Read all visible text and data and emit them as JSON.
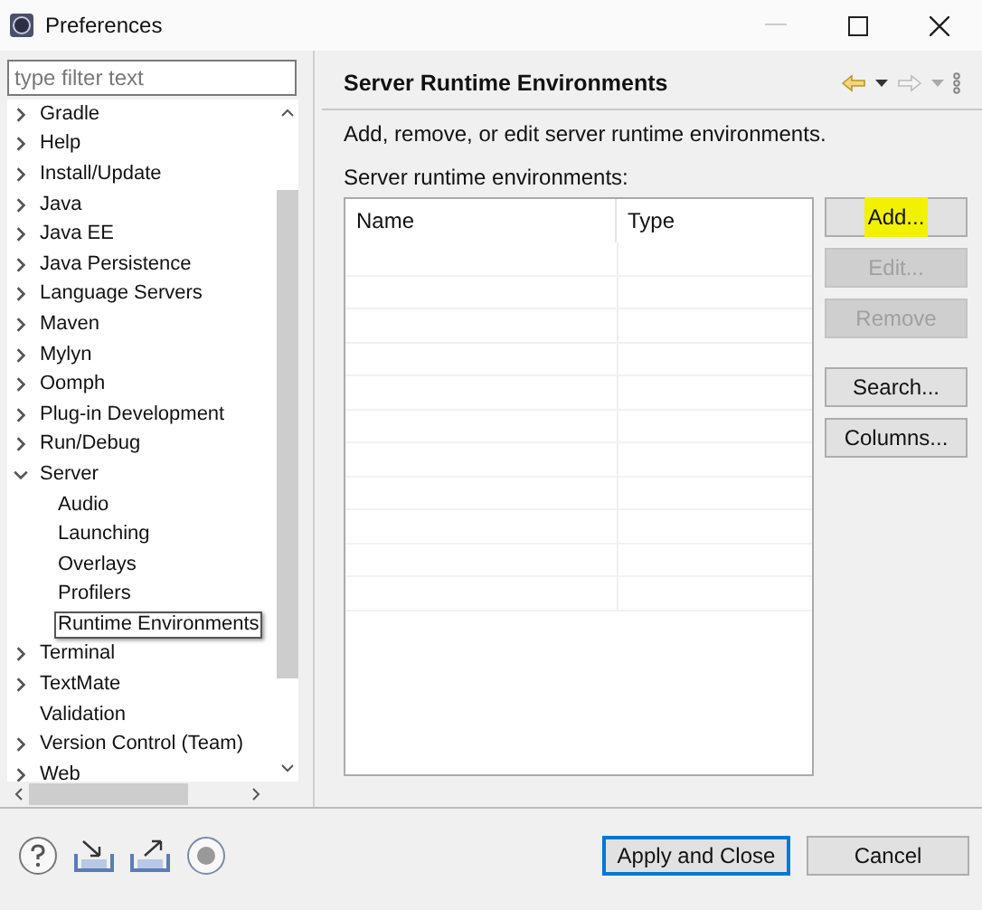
{
  "window": {
    "title": "Preferences"
  },
  "filter": {
    "placeholder": "type filter text"
  },
  "tree": [
    {
      "label": "Gradle",
      "expandable": true,
      "expanded": false,
      "selected": false
    },
    {
      "label": "Help",
      "expandable": true,
      "expanded": false,
      "selected": false
    },
    {
      "label": "Install/Update",
      "expandable": true,
      "expanded": false,
      "selected": false
    },
    {
      "label": "Java",
      "expandable": true,
      "expanded": false,
      "selected": false
    },
    {
      "label": "Java EE",
      "expandable": true,
      "expanded": false,
      "selected": false
    },
    {
      "label": "Java Persistence",
      "expandable": true,
      "expanded": false,
      "selected": false
    },
    {
      "label": "Language Servers",
      "expandable": true,
      "expanded": false,
      "selected": false
    },
    {
      "label": "Maven",
      "expandable": true,
      "expanded": false,
      "selected": false
    },
    {
      "label": "Mylyn",
      "expandable": true,
      "expanded": false,
      "selected": false
    },
    {
      "label": "Oomph",
      "expandable": true,
      "expanded": false,
      "selected": false
    },
    {
      "label": "Plug-in Development",
      "expandable": true,
      "expanded": false,
      "selected": false
    },
    {
      "label": "Run/Debug",
      "expandable": true,
      "expanded": false,
      "selected": false
    },
    {
      "label": "Server",
      "expandable": true,
      "expanded": true,
      "selected": false,
      "children": [
        {
          "label": "Audio",
          "expandable": false,
          "selected": false
        },
        {
          "label": "Launching",
          "expandable": false,
          "selected": false
        },
        {
          "label": "Overlays",
          "expandable": false,
          "selected": false
        },
        {
          "label": "Profilers",
          "expandable": false,
          "selected": false
        },
        {
          "label": "Runtime Environments",
          "expandable": false,
          "selected": true
        }
      ]
    },
    {
      "label": "Terminal",
      "expandable": true,
      "expanded": false,
      "selected": false
    },
    {
      "label": "TextMate",
      "expandable": true,
      "expanded": false,
      "selected": false
    },
    {
      "label": "Validation",
      "expandable": false,
      "selected": false
    },
    {
      "label": "Version Control (Team)",
      "expandable": true,
      "expanded": false,
      "selected": false
    },
    {
      "label": "Web",
      "expandable": true,
      "expanded": false,
      "selected": false
    }
  ],
  "page": {
    "title": "Server Runtime Environments",
    "description": "Add, remove, or edit server runtime environments.",
    "table_label": "Server runtime environments:"
  },
  "table": {
    "columns": [
      "Name",
      "Type"
    ]
  },
  "side_buttons": [
    {
      "label": "Add...",
      "disabled": false,
      "highlighted": true
    },
    {
      "label": "Edit...",
      "disabled": true,
      "highlighted": false
    },
    {
      "label": "Remove",
      "disabled": true,
      "highlighted": false
    },
    {
      "label": "Search...",
      "disabled": false,
      "highlighted": false
    },
    {
      "label": "Columns...",
      "disabled": false,
      "highlighted": false
    }
  ],
  "footer_buttons": [
    {
      "label": "Apply and Close",
      "selected": true
    },
    {
      "label": "Cancel",
      "selected": false
    }
  ]
}
